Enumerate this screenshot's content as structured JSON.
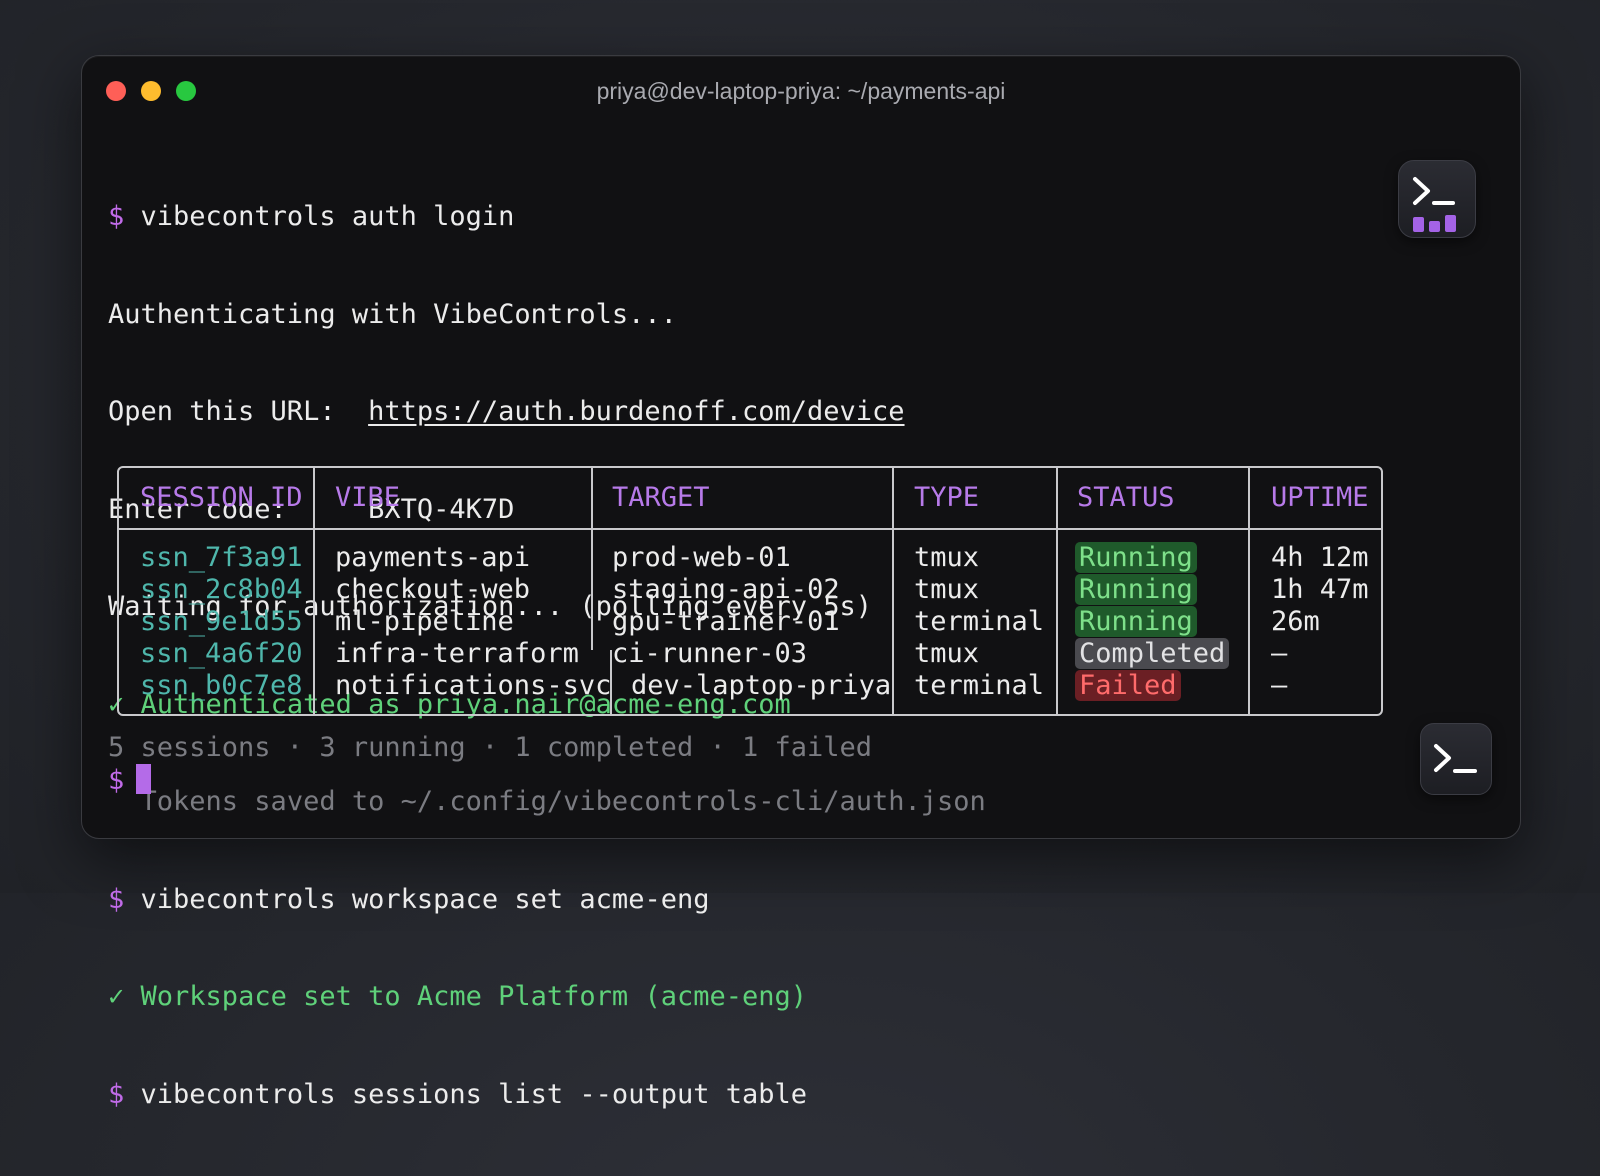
{
  "window": {
    "title": "priya@dev-laptop-priya: ~/payments-api"
  },
  "prompt_symbol": "$",
  "check_symbol": "✓",
  "lines": {
    "cmd1": "vibecontrols auth login",
    "auth1": "Authenticating with VibeControls...",
    "open_label": "Open this URL:  ",
    "open_url": "https://auth.burdenoff.com/device",
    "code_label": "Enter code:     ",
    "code_value": "BXTQ-4K7D",
    "waiting": "Waiting for authorization... (polling every 5s)",
    "authed": "Authenticated as priya.nair@acme-eng.com",
    "tokens": "Tokens saved to ~/.config/vibecontrols-cli/auth.json",
    "cmd2": "vibecontrols workspace set acme-eng",
    "ws_set": "Workspace set to Acme Platform (acme-eng)",
    "cmd3": "vibecontrols sessions list --output table"
  },
  "table": {
    "headers": [
      "SESSION ID",
      "VIBE",
      "TARGET",
      "TYPE",
      "STATUS",
      "UPTIME"
    ],
    "rows": [
      {
        "id": "ssn_7f3a91",
        "vibe": "payments-api",
        "target": "prod-web-01",
        "type": "tmux",
        "status": "Running",
        "uptime": "4h 12m"
      },
      {
        "id": "ssn_2c8b04",
        "vibe": "checkout-web",
        "target": "staging-api-02",
        "type": "tmux",
        "status": "Running",
        "uptime": "1h 47m"
      },
      {
        "id": "ssn_9e1d55",
        "vibe": "ml-pipeline",
        "target": "gpu-trainer-01",
        "type": "terminal",
        "status": "Running",
        "uptime": "26m"
      },
      {
        "id": "ssn_4a6f20",
        "vibe": "infra-terraform",
        "target": "ci-runner-03",
        "type": "tmux",
        "status": "Completed",
        "uptime": "—"
      },
      {
        "id": "ssn_b0c7e8",
        "vibe": "notifications-svc",
        "target": "dev-laptop-priya",
        "type": "terminal",
        "status": "Failed",
        "uptime": "—"
      }
    ]
  },
  "summary": "5 sessions · 3 running · 1 completed · 1 failed",
  "colors": {
    "prompt": "#c06be8",
    "success": "#5fd17a",
    "session_id": "#4fb7ac",
    "header": "#b77ae9"
  },
  "icons": {
    "app": "terminal-bars-icon",
    "terminal": "terminal-prompt-icon"
  }
}
